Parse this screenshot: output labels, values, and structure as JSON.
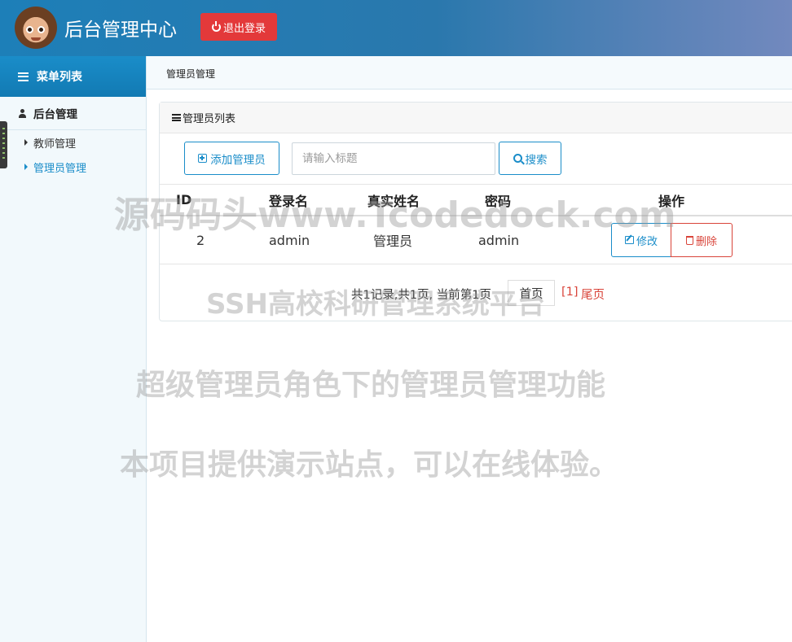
{
  "header": {
    "app_title": "后台管理中心",
    "logout_label": "退出登录"
  },
  "sidebar": {
    "menu_title": "菜单列表",
    "group_label": "后台管理",
    "items": [
      {
        "label": "教师管理",
        "active": false
      },
      {
        "label": "管理员管理",
        "active": true
      }
    ]
  },
  "breadcrumb": "管理员管理",
  "panel": {
    "title": "管理员列表",
    "add_label": "添加管理员",
    "search_placeholder": "请输入标题",
    "search_label": "搜索"
  },
  "table": {
    "columns": [
      "ID",
      "登录名",
      "真实姓名",
      "密码",
      "操作"
    ],
    "rows": [
      {
        "id": "2",
        "login": "admin",
        "name": "管理员",
        "password": "admin",
        "edit_label": "修改",
        "delete_label": "删除"
      }
    ]
  },
  "pagination": {
    "info": "共1记录,共1页, 当前第1页",
    "first_label": "首页",
    "current": "[1]",
    "last_label": "尾页"
  },
  "watermarks": {
    "line1": "源码码头www.Tcodedock.com",
    "line2": "SSH高校科研管理系统平台",
    "line3": "超级管理员角色下的管理员管理功能",
    "line4": "本项目提供演示站点，可以在线体验。"
  },
  "colors": {
    "primary": "#1a8dc9",
    "danger": "#e3393a"
  }
}
